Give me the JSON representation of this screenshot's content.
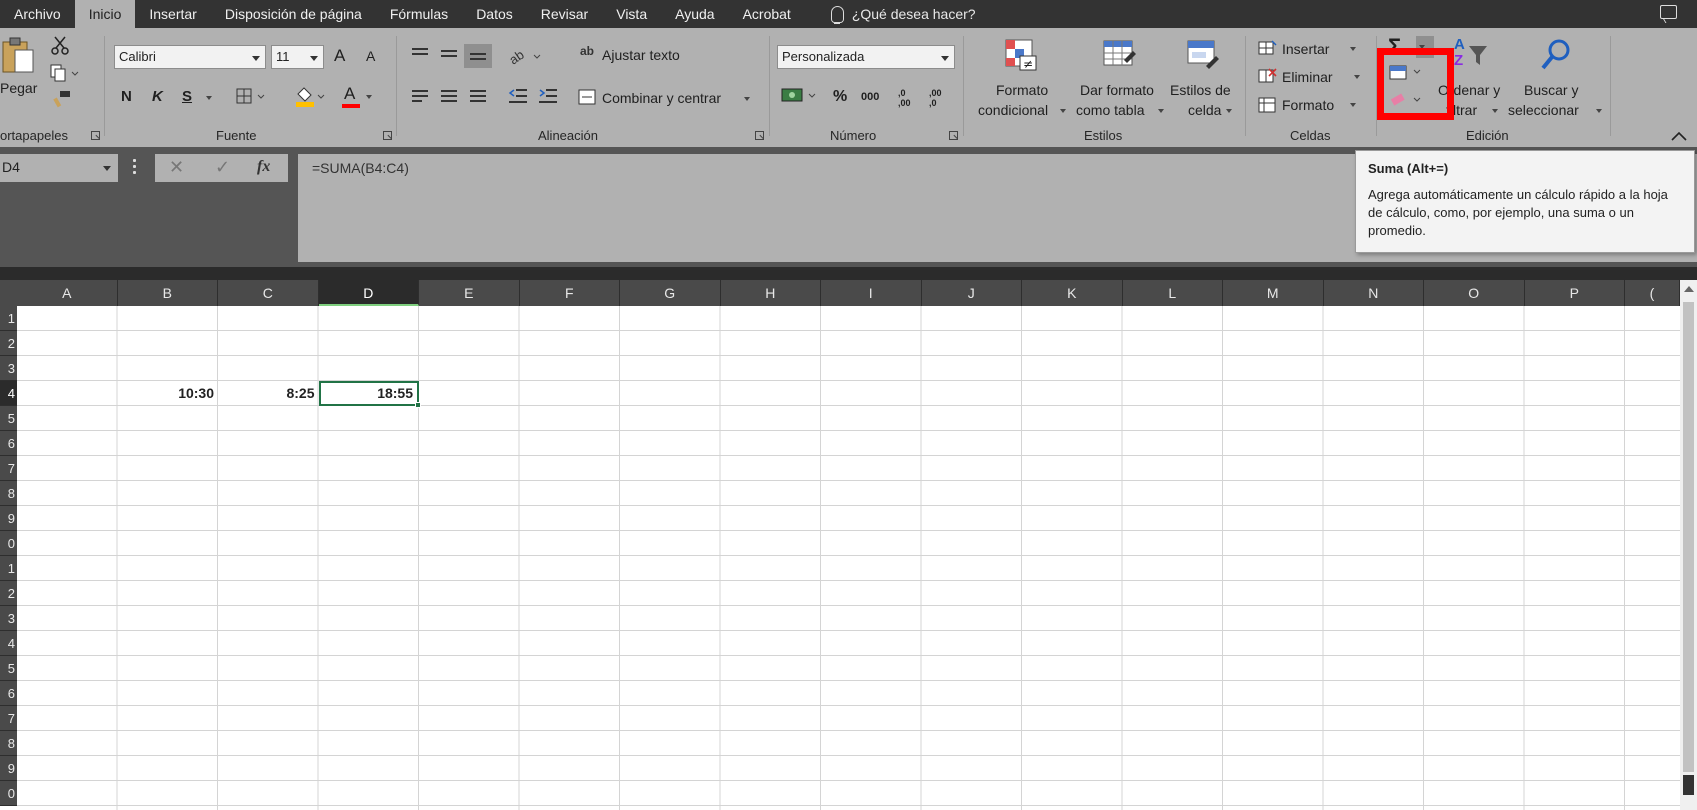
{
  "tabs": [
    "Archivo",
    "Inicio",
    "Insertar",
    "Disposición de página",
    "Fórmulas",
    "Datos",
    "Revisar",
    "Vista",
    "Ayuda",
    "Acrobat"
  ],
  "active_tab": "Inicio",
  "tell_me": "¿Qué desea hacer?",
  "ribbon": {
    "clipboard": {
      "paste": "Pegar",
      "label": "ortapapeles"
    },
    "font": {
      "family": "Calibri",
      "size": "11",
      "grow": "A",
      "shrink": "A",
      "bold": "N",
      "italic": "K",
      "underline": "S",
      "color_letter": "A",
      "label": "Fuente"
    },
    "alignment": {
      "wrap": "Ajustar texto",
      "merge": "Combinar y centrar",
      "label": "Alineación",
      "wrap_icon": "ab"
    },
    "number": {
      "format": "Personalizada",
      "percent": "%",
      "thousands": "000",
      "inc_dec": ",0 ,00",
      "dec_dec": ",00 ,0",
      "label": "Número"
    },
    "styles": {
      "conditional": [
        "Formato",
        "condicional"
      ],
      "as_table": [
        "Dar formato",
        "como tabla"
      ],
      "cell_styles": [
        "Estilos de",
        "celda"
      ],
      "label": "Estilos"
    },
    "cells": {
      "insert": "Insertar",
      "delete": "Eliminar",
      "format": "Formato",
      "label": "Celdas"
    },
    "editing": {
      "autosum": "Σ",
      "sort": [
        "Ordenar y",
        "filtrar"
      ],
      "find": [
        "Buscar y",
        "seleccionar"
      ],
      "label": "Edición",
      "sort_a": "A",
      "sort_z": "Z"
    }
  },
  "name_box": "D4",
  "fx": "fx",
  "formula": "=SUMA(B4:C4)",
  "tooltip": {
    "title": "Suma (Alt+=)",
    "body": "Agrega automáticamente un cálculo rápido a la hoja de cálculo, como, por ejemplo, una suma o un promedio."
  },
  "columns": [
    "A",
    "B",
    "C",
    "D",
    "E",
    "F",
    "G",
    "H",
    "I",
    "J",
    "K",
    "L",
    "M",
    "N",
    "O",
    "P",
    "("
  ],
  "rows": [
    "1",
    "2",
    "3",
    "4",
    "5",
    "6",
    "7",
    "8",
    "9",
    "0",
    "1",
    "2",
    "3",
    "4",
    "5",
    "6",
    "7",
    "8",
    "9",
    "0"
  ],
  "selected_column": "D",
  "selected_row": "4",
  "cells": [
    {
      "ref": "B4",
      "value": "10:30"
    },
    {
      "ref": "C4",
      "value": "8:25"
    },
    {
      "ref": "D4",
      "value": "18:55"
    }
  ],
  "colors": {
    "accent": "#217346",
    "highlight": "#ff0000",
    "ribbon": "#b1b1b1",
    "dark": "#333333"
  }
}
